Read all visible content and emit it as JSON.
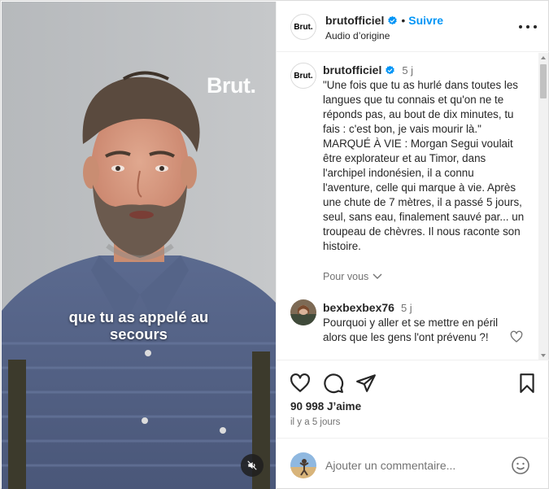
{
  "video": {
    "watermark": "Brut.",
    "subtitle_line1": "que tu as appelé au",
    "subtitle_line2": "secours",
    "mute_icon": "speaker-muted-icon"
  },
  "header": {
    "avatar_text": "Brut.",
    "username": "brutofficiel",
    "separator": "•",
    "follow_label": "Suivre",
    "audio_label": "Audio d’origine",
    "more_icon": "more-horizontal-icon"
  },
  "caption": {
    "avatar_text": "Brut.",
    "username": "brutofficiel",
    "time": "5 j",
    "text": "\"Une fois que tu as hurlé dans toutes les langues que tu connais et qu'on ne te réponds pas, au bout de dix minutes, tu fais : c'est bon, je vais mourir là.\" MARQUÉ À VIE : Morgan Segui voulait être explorateur et au Timor, dans l'archipel indonésien, il a connu l'aventure, celle qui marque à vie. Après une chute de 7 mètres, il a passé 5 jours, seul, sans eau, finalement sauvé par... un troupeau de chèvres. Il nous raconte son histoire.",
    "see_translation": "Pour vous"
  },
  "comment": {
    "username": "bexbexbex76",
    "time": "5 j",
    "text": "Pourquoi y aller et se mettre en péril alors que les gens l'ont prévenu ?!"
  },
  "actions": {
    "icons": [
      "heart-icon",
      "comment-icon",
      "share-icon",
      "bookmark-icon"
    ]
  },
  "likes": "90 998 J’aime",
  "timeago": "il y a 5 jours",
  "add_comment": {
    "placeholder": "Ajouter un commentaire...",
    "emoji_icon": "emoji-icon"
  },
  "colors": {
    "accent": "#0095f6",
    "verified": "#0095f6",
    "text": "#262626",
    "muted": "#737373",
    "border": "#dbdbdb"
  }
}
